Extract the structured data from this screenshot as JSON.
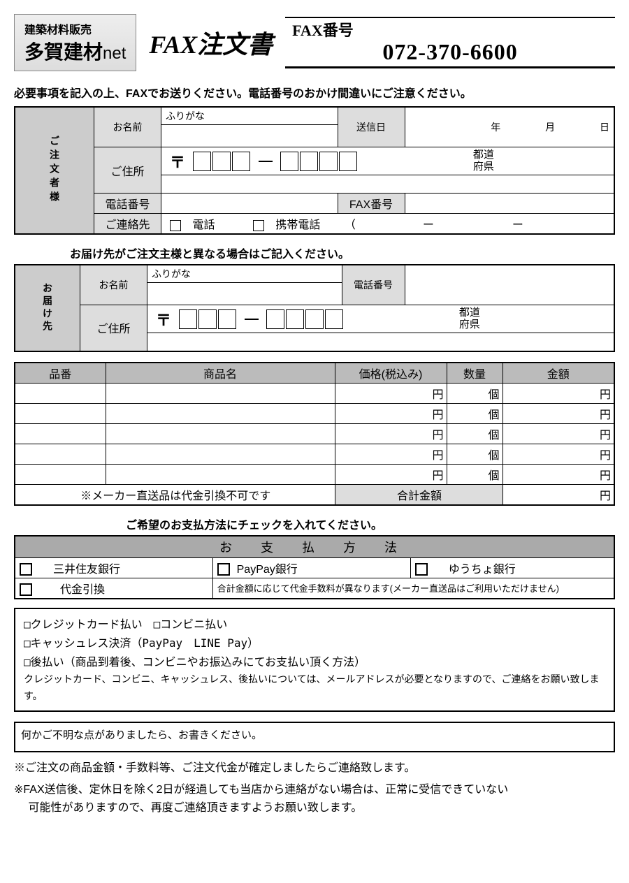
{
  "header": {
    "logo_tagline": "建築材料販売",
    "logo_name": "多賀建材",
    "logo_suffix": "net",
    "title": "FAX注文書",
    "fax_label": "FAX番号",
    "fax_number": "072-370-6600"
  },
  "instructions": {
    "main": "必要事項を記入の上、FAXでお送りください。電話番号のおかけ間違いにご注意ください。",
    "delivery": "お届け先がご注文主様と異なる場合はご記入ください。",
    "payment": "ご希望のお支払方法にチェックを入れてください。"
  },
  "orderer": {
    "section": "ご注文者様",
    "name_label": "お名前",
    "furigana_label": "ふりがな",
    "send_date_label": "送信日",
    "year": "年",
    "month": "月",
    "day": "日",
    "address_label": "ご住所",
    "prefecture1": "都道",
    "prefecture2": "府県",
    "phone_label": "電話番号",
    "fax_label": "FAX番号",
    "contact_label": "ご連絡先",
    "contact_phone": "電話",
    "contact_mobile": "携帯電話"
  },
  "delivery": {
    "section": "お届け先",
    "name_label": "お名前",
    "furigana_label": "ふりがな",
    "phone_label": "電話番号",
    "address_label": "ご住所",
    "prefecture1": "都道",
    "prefecture2": "府県"
  },
  "products": {
    "headers": {
      "code": "品番",
      "name": "商品名",
      "price": "価格(税込み)",
      "qty": "数量",
      "amount": "金額"
    },
    "yen": "円",
    "unit": "個",
    "cod_note": "※メーカー直送品は代金引換不可です",
    "total_label": "合計金額"
  },
  "payment": {
    "header": "お 支 払 方 法",
    "opt1": "三井住友銀行",
    "opt2": "PayPay銀行",
    "opt3": "ゆうちょ銀行",
    "opt4": "代金引換",
    "cod_note": "合計金額に応じて代金手数料が異なります(メーカー直送品はご利用いただけません)",
    "extra1": "□クレジットカード払い　□コンビニ払い",
    "extra2": "□キャッシュレス決済（PayPay　LINE Pay）",
    "extra3": "□後払い（商品到着後、コンビニやお振込みにてお支払い頂く方法）",
    "extra_note": "クレジットカード、コンビニ、キャッシュレス、後払いについては、メールアドレスが必要となりますので、ご連絡をお願い致します。"
  },
  "free_text": "何かご不明な点がありましたら、お書きください。",
  "footer": {
    "note1": "※ご注文の商品金額・手数料等、ご注文代金が確定しましたらご連絡致します。",
    "note2": "※FAX送信後、定休日を除く2日が経過しても当店から連絡がない場合は、正常に受信できていない",
    "note2b": "　 可能性がありますので、再度ご連絡頂きますようお願い致します。"
  }
}
